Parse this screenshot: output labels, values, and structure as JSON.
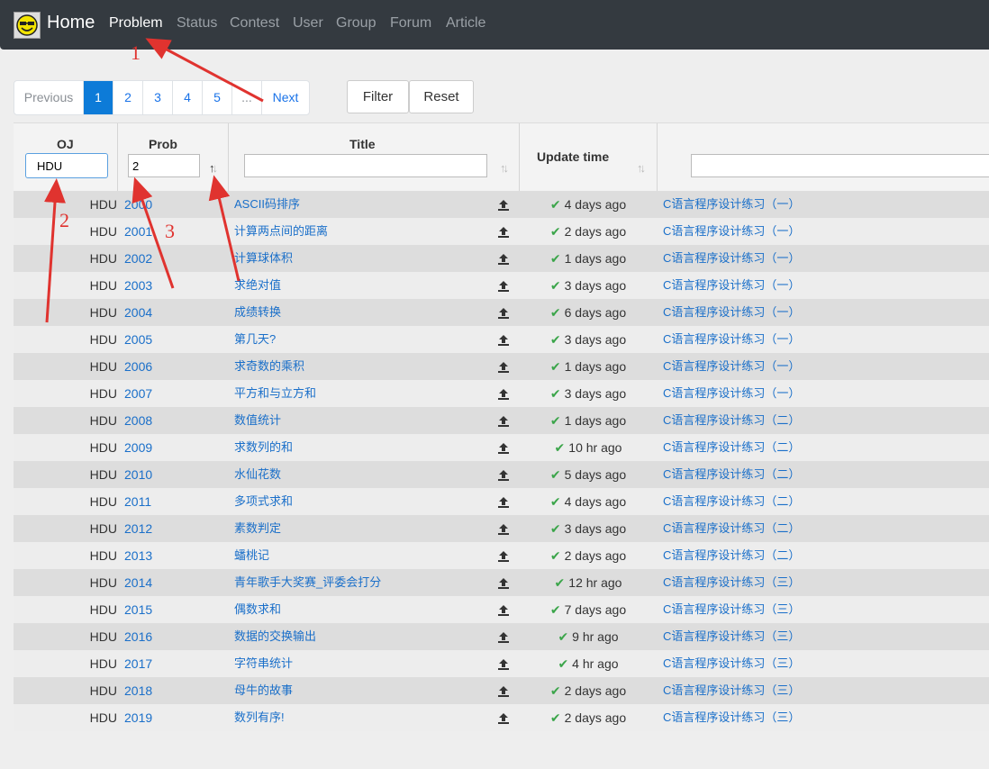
{
  "navbar": {
    "brand": "Home",
    "items": [
      "Problem",
      "Status",
      "Contest",
      "User",
      "Group",
      "Forum",
      "Article"
    ]
  },
  "pagination": {
    "previous": "Previous",
    "pages": [
      "1",
      "2",
      "3",
      "4",
      "5",
      "..."
    ],
    "next": "Next",
    "current": "1"
  },
  "buttons": {
    "filter": "Filter",
    "reset": "Reset"
  },
  "table": {
    "headers": {
      "oj": "OJ",
      "prob": "Prob",
      "title": "Title",
      "update_time": "Update time"
    },
    "filters": {
      "oj": "HDU",
      "prob": "2",
      "title": "",
      "source": ""
    },
    "rows": [
      {
        "oj": "HDU",
        "prob": "2000",
        "title": "ASCII码排序",
        "time": "4 days ago",
        "source": "C语言程序设计练习（一）"
      },
      {
        "oj": "HDU",
        "prob": "2001",
        "title": "计算两点间的距离",
        "time": "2 days ago",
        "source": "C语言程序设计练习（一）"
      },
      {
        "oj": "HDU",
        "prob": "2002",
        "title": "计算球体积",
        "time": "1 days ago",
        "source": "C语言程序设计练习（一）"
      },
      {
        "oj": "HDU",
        "prob": "2003",
        "title": "求绝对值",
        "time": "3 days ago",
        "source": "C语言程序设计练习（一）"
      },
      {
        "oj": "HDU",
        "prob": "2004",
        "title": "成绩转换",
        "time": "6 days ago",
        "source": "C语言程序设计练习（一）"
      },
      {
        "oj": "HDU",
        "prob": "2005",
        "title": "第几天?",
        "time": "3 days ago",
        "source": "C语言程序设计练习（一）"
      },
      {
        "oj": "HDU",
        "prob": "2006",
        "title": "求奇数的乘积",
        "time": "1 days ago",
        "source": "C语言程序设计练习（一）"
      },
      {
        "oj": "HDU",
        "prob": "2007",
        "title": "平方和与立方和",
        "time": "3 days ago",
        "source": "C语言程序设计练习（一）"
      },
      {
        "oj": "HDU",
        "prob": "2008",
        "title": "数值统计",
        "time": "1 days ago",
        "source": "C语言程序设计练习（二）"
      },
      {
        "oj": "HDU",
        "prob": "2009",
        "title": "求数列的和",
        "time": "10 hr ago",
        "source": "C语言程序设计练习（二）"
      },
      {
        "oj": "HDU",
        "prob": "2010",
        "title": "水仙花数",
        "time": "5 days ago",
        "source": "C语言程序设计练习（二）"
      },
      {
        "oj": "HDU",
        "prob": "2011",
        "title": "多项式求和",
        "time": "4 days ago",
        "source": "C语言程序设计练习（二）"
      },
      {
        "oj": "HDU",
        "prob": "2012",
        "title": "素数判定",
        "time": "3 days ago",
        "source": "C语言程序设计练习（二）"
      },
      {
        "oj": "HDU",
        "prob": "2013",
        "title": "蟠桃记",
        "time": "2 days ago",
        "source": "C语言程序设计练习（二）"
      },
      {
        "oj": "HDU",
        "prob": "2014",
        "title": "青年歌手大奖赛_评委会打分",
        "time": "12 hr ago",
        "source": "C语言程序设计练习（三）"
      },
      {
        "oj": "HDU",
        "prob": "2015",
        "title": "偶数求和",
        "time": "7 days ago",
        "source": "C语言程序设计练习（三）"
      },
      {
        "oj": "HDU",
        "prob": "2016",
        "title": "数据的交换输出",
        "time": "9 hr ago",
        "source": "C语言程序设计练习（三）"
      },
      {
        "oj": "HDU",
        "prob": "2017",
        "title": "字符串统计",
        "time": "4 hr ago",
        "source": "C语言程序设计练习（三）"
      },
      {
        "oj": "HDU",
        "prob": "2018",
        "title": "母牛的故事",
        "time": "2 days ago",
        "source": "C语言程序设计练习（三）"
      },
      {
        "oj": "HDU",
        "prob": "2019",
        "title": "数列有序!",
        "time": "2 days ago",
        "source": "C语言程序设计练习（三）"
      }
    ]
  },
  "annotations": {
    "a1": "1",
    "a2": "2",
    "a3": "3",
    "color": "#e0332f"
  },
  "colors": {
    "navbar": "#343a40",
    "link": "#1a6fc9",
    "active_page": "#0d7bd8",
    "check": "#3ba54a"
  }
}
